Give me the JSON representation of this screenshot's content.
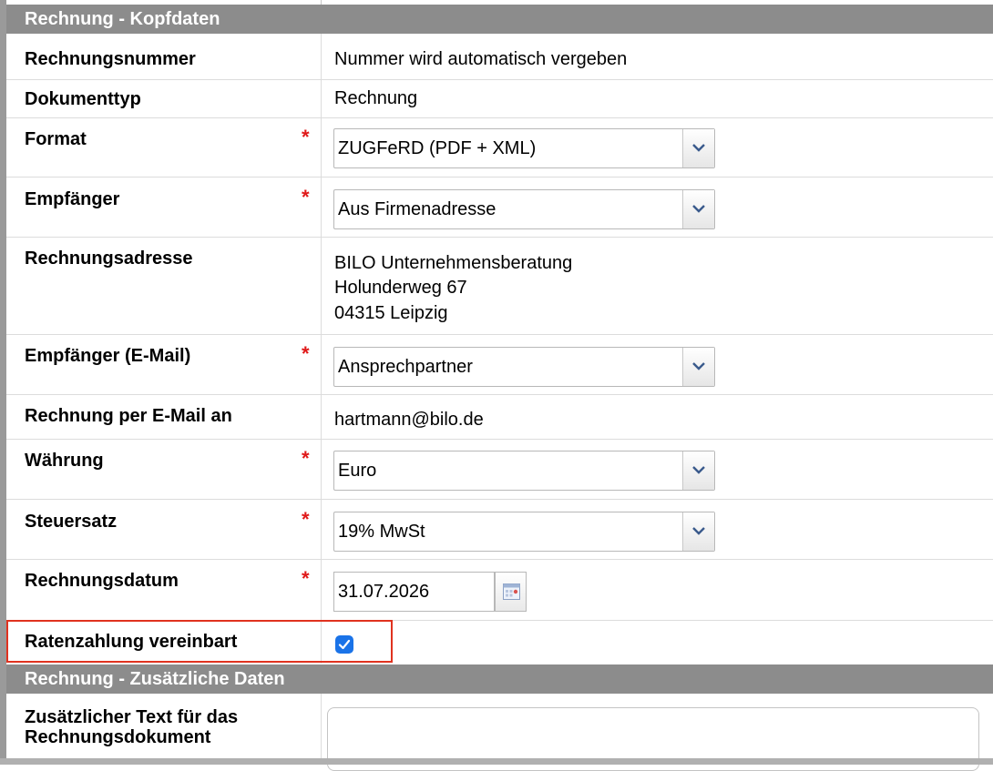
{
  "section_header": {
    "title": "Rechnung - Kopfdaten"
  },
  "rows": {
    "rechnungsnummer": {
      "label": "Rechnungsnummer",
      "value": "Nummer wird automatisch vergeben"
    },
    "dokumenttyp": {
      "label": "Dokumenttyp",
      "value": "Rechnung"
    },
    "format": {
      "label": "Format",
      "required": "*",
      "selected": "ZUGFeRD (PDF + XML)"
    },
    "empfaenger": {
      "label": "Empfänger",
      "required": "*",
      "selected": "Aus Firmenadresse"
    },
    "rechnungsadresse": {
      "label": "Rechnungsadresse",
      "lines": [
        "BILO Unternehmensberatung",
        "Holunderweg 67",
        "04315 Leipzig"
      ]
    },
    "empfaenger_email": {
      "label": "Empfänger (E-Mail)",
      "required": "*",
      "selected": "Ansprechpartner"
    },
    "email_an": {
      "label": "Rechnung per E-Mail an",
      "value": "hartmann@bilo.de"
    },
    "waehrung": {
      "label": "Währung",
      "required": "*",
      "selected": "Euro"
    },
    "steuersatz": {
      "label": "Steuersatz",
      "required": "*",
      "selected": "19% MwSt"
    },
    "rechnungsdatum": {
      "label": "Rechnungsdatum",
      "required": "*",
      "value": "31.07.2026"
    },
    "ratenzahlung": {
      "label": "Ratenzahlung vereinbart",
      "checked": true
    }
  },
  "section_header_2": {
    "title": "Rechnung - Zusätzliche Daten"
  },
  "zusatztext": {
    "label_line1": "Zusätzlicher Text für das",
    "label_line2": "Rechnungsdokument",
    "value": ""
  },
  "colors": {
    "header_bg": "#8c8c8c",
    "required": "#e01919",
    "checkbox": "#1a73e8",
    "highlight": "#e0321f"
  }
}
